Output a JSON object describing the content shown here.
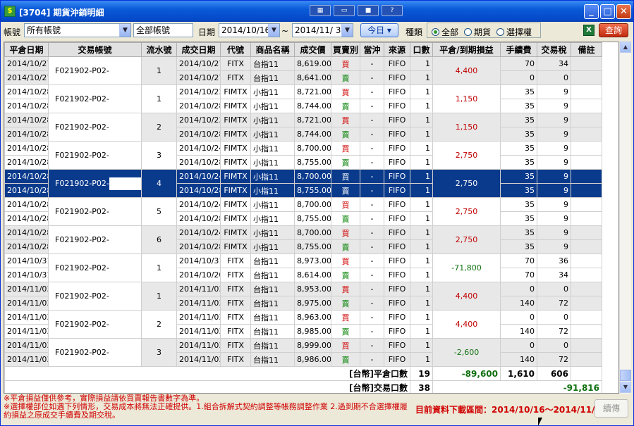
{
  "window": {
    "title": "[3704] 期貨沖銷明細",
    "toolbar_icons": [
      "grid-icon",
      "window-icon",
      "camera-icon",
      "help-icon"
    ],
    "help_label": "?"
  },
  "filters": {
    "account_label": "帳號",
    "account_value": "所有帳號",
    "account_name_value": "全部帳號",
    "date_label": "日期",
    "date_from": "2014/10/16",
    "date_sep": "~",
    "date_to": "2014/11/ 3",
    "today_button": "今日",
    "type_label": "種類",
    "type_options": [
      "全部",
      "期貨",
      "選擇權"
    ],
    "type_selected": "全部",
    "query_button": "查詢"
  },
  "table": {
    "columns": [
      "平倉日期",
      "交易帳號",
      "流水號",
      "成交日期",
      "代號",
      "商品名稱",
      "成交價",
      "買賣別",
      "當沖",
      "來源",
      "口數",
      "平倉/到期損益",
      "手續費",
      "交易稅",
      "備註"
    ],
    "groups": [
      {
        "close_date": "2014/10/27",
        "account": "F021902-P02-",
        "seq": "1",
        "pnl": "4,400",
        "pnl_sign": "pos",
        "rows": [
          {
            "close_date": "2014/10/27",
            "trade_date": "2014/10/27",
            "code": "FITX",
            "name": "台指11",
            "price": "8,619.00",
            "side": "買",
            "daytrade": "-",
            "source": "FIFO",
            "qty": "1",
            "fee": "70",
            "tax": "34"
          },
          {
            "close_date": "2014/10/27",
            "trade_date": "2014/10/27",
            "code": "FITX",
            "name": "台指11",
            "price": "8,641.00",
            "side": "賣",
            "daytrade": "-",
            "source": "FIFO",
            "qty": "1",
            "fee": "0",
            "tax": "0"
          }
        ]
      },
      {
        "close_date": "2014/10/28",
        "account": "F021902-P02-",
        "seq": "1",
        "pnl": "1,150",
        "pnl_sign": "pos",
        "rows": [
          {
            "close_date": "2014/10/28",
            "trade_date": "2014/10/23",
            "code": "FIMTX",
            "name": "小指11",
            "price": "8,721.00",
            "side": "買",
            "daytrade": "-",
            "source": "FIFO",
            "qty": "1",
            "fee": "35",
            "tax": "9"
          },
          {
            "close_date": "2014/10/28",
            "trade_date": "2014/10/28",
            "code": "FIMTX",
            "name": "小指11",
            "price": "8,744.00",
            "side": "賣",
            "daytrade": "-",
            "source": "FIFO",
            "qty": "1",
            "fee": "35",
            "tax": "9"
          }
        ]
      },
      {
        "close_date": "2014/10/28",
        "account": "F021902-P02-",
        "seq": "2",
        "pnl": "1,150",
        "pnl_sign": "pos",
        "rows": [
          {
            "close_date": "2014/10/28",
            "trade_date": "2014/10/23",
            "code": "FIMTX",
            "name": "小指11",
            "price": "8,721.00",
            "side": "買",
            "daytrade": "-",
            "source": "FIFO",
            "qty": "1",
            "fee": "35",
            "tax": "9"
          },
          {
            "close_date": "2014/10/28",
            "trade_date": "2014/10/28",
            "code": "FIMTX",
            "name": "小指11",
            "price": "8,744.00",
            "side": "賣",
            "daytrade": "-",
            "source": "FIFO",
            "qty": "1",
            "fee": "35",
            "tax": "9"
          }
        ]
      },
      {
        "close_date": "2014/10/28",
        "account": "F021902-P02-",
        "seq": "3",
        "pnl": "2,750",
        "pnl_sign": "pos",
        "rows": [
          {
            "close_date": "2014/10/28",
            "trade_date": "2014/10/24",
            "code": "FIMTX",
            "name": "小指11",
            "price": "8,700.00",
            "side": "買",
            "daytrade": "-",
            "source": "FIFO",
            "qty": "1",
            "fee": "35",
            "tax": "9"
          },
          {
            "close_date": "2014/10/28",
            "trade_date": "2014/10/28",
            "code": "FIMTX",
            "name": "小指11",
            "price": "8,755.00",
            "side": "賣",
            "daytrade": "-",
            "source": "FIFO",
            "qty": "1",
            "fee": "35",
            "tax": "9"
          }
        ]
      },
      {
        "close_date": "2014/10/28",
        "account": "F021902-P02-",
        "seq": "4",
        "pnl": "2,750",
        "pnl_sign": "pos",
        "selected": true,
        "rows": [
          {
            "close_date": "2014/10/28",
            "trade_date": "2014/10/24",
            "code": "FIMTX",
            "name": "小指11",
            "price": "8,700.00",
            "side": "買",
            "daytrade": "-",
            "source": "FIFO",
            "qty": "1",
            "fee": "35",
            "tax": "9"
          },
          {
            "close_date": "2014/10/28",
            "trade_date": "2014/10/28",
            "code": "FIMTX",
            "name": "小指11",
            "price": "8,755.00",
            "side": "賣",
            "daytrade": "-",
            "source": "FIFO",
            "qty": "1",
            "fee": "35",
            "tax": "9"
          }
        ]
      },
      {
        "close_date": "2014/10/28",
        "account": "F021902-P02-",
        "seq": "5",
        "pnl": "2,750",
        "pnl_sign": "pos",
        "rows": [
          {
            "close_date": "2014/10/28",
            "trade_date": "2014/10/24",
            "code": "FIMTX",
            "name": "小指11",
            "price": "8,700.00",
            "side": "買",
            "daytrade": "-",
            "source": "FIFO",
            "qty": "1",
            "fee": "35",
            "tax": "9"
          },
          {
            "close_date": "2014/10/28",
            "trade_date": "2014/10/28",
            "code": "FIMTX",
            "name": "小指11",
            "price": "8,755.00",
            "side": "賣",
            "daytrade": "-",
            "source": "FIFO",
            "qty": "1",
            "fee": "35",
            "tax": "9"
          }
        ]
      },
      {
        "close_date": "2014/10/28",
        "account": "F021902-P02-",
        "seq": "6",
        "pnl": "2,750",
        "pnl_sign": "pos",
        "rows": [
          {
            "close_date": "2014/10/28",
            "trade_date": "2014/10/24",
            "code": "FIMTX",
            "name": "小指11",
            "price": "8,700.00",
            "side": "買",
            "daytrade": "-",
            "source": "FIFO",
            "qty": "1",
            "fee": "35",
            "tax": "9"
          },
          {
            "close_date": "2014/10/28",
            "trade_date": "2014/10/28",
            "code": "FIMTX",
            "name": "小指11",
            "price": "8,755.00",
            "side": "賣",
            "daytrade": "-",
            "source": "FIFO",
            "qty": "1",
            "fee": "35",
            "tax": "9"
          }
        ]
      },
      {
        "close_date": "2014/10/31",
        "account": "F021902-P02-",
        "seq": "1",
        "pnl": "-71,800",
        "pnl_sign": "neg",
        "rows": [
          {
            "close_date": "2014/10/31",
            "trade_date": "2014/10/31",
            "code": "FITX",
            "name": "台指11",
            "price": "8,973.00",
            "side": "買",
            "daytrade": "-",
            "source": "FIFO",
            "qty": "1",
            "fee": "70",
            "tax": "36"
          },
          {
            "close_date": "2014/10/31",
            "trade_date": "2014/10/20",
            "code": "FITX",
            "name": "台指11",
            "price": "8,614.00",
            "side": "賣",
            "daytrade": "-",
            "source": "FIFO",
            "qty": "1",
            "fee": "70",
            "tax": "34"
          }
        ]
      },
      {
        "close_date": "2014/11/03",
        "account": "F021902-P02-",
        "seq": "1",
        "pnl": "4,400",
        "pnl_sign": "pos",
        "rows": [
          {
            "close_date": "2014/11/03",
            "trade_date": "2014/11/03",
            "code": "FITX",
            "name": "台指11",
            "price": "8,953.00",
            "side": "買",
            "daytrade": "-",
            "source": "FIFO",
            "qty": "1",
            "fee": "0",
            "tax": "0"
          },
          {
            "close_date": "2014/11/03",
            "trade_date": "2014/11/03",
            "code": "FITX",
            "name": "台指11",
            "price": "8,975.00",
            "side": "賣",
            "daytrade": "-",
            "source": "FIFO",
            "qty": "1",
            "fee": "140",
            "tax": "72"
          }
        ]
      },
      {
        "close_date": "2014/11/03",
        "account": "F021902-P02-",
        "seq": "2",
        "pnl": "4,400",
        "pnl_sign": "pos",
        "rows": [
          {
            "close_date": "2014/11/03",
            "trade_date": "2014/11/03",
            "code": "FITX",
            "name": "台指11",
            "price": "8,963.00",
            "side": "買",
            "daytrade": "-",
            "source": "FIFO",
            "qty": "1",
            "fee": "0",
            "tax": "0"
          },
          {
            "close_date": "2014/11/03",
            "trade_date": "2014/11/03",
            "code": "FITX",
            "name": "台指11",
            "price": "8,985.00",
            "side": "賣",
            "daytrade": "-",
            "source": "FIFO",
            "qty": "1",
            "fee": "140",
            "tax": "72"
          }
        ]
      },
      {
        "close_date": "2014/11/03",
        "account": "F021902-P02-",
        "seq": "3",
        "pnl": "-2,600",
        "pnl_sign": "neg",
        "rows": [
          {
            "close_date": "2014/11/03",
            "trade_date": "2014/11/03",
            "code": "FITX",
            "name": "台指11",
            "price": "8,999.00",
            "side": "買",
            "daytrade": "-",
            "source": "FIFO",
            "qty": "1",
            "fee": "0",
            "tax": "0"
          },
          {
            "close_date": "2014/11/03",
            "trade_date": "2014/11/03",
            "code": "FITX",
            "name": "台指11",
            "price": "8,986.00",
            "side": "賣",
            "daytrade": "-",
            "source": "FIFO",
            "qty": "1",
            "fee": "140",
            "tax": "72"
          }
        ]
      }
    ],
    "totals": {
      "close_label": "[台幣]平倉口數",
      "close_qty": "19",
      "close_pnl": "-89,600",
      "close_fee": "1,610",
      "close_tax": "606",
      "trade_label": "[台幣]交易口數",
      "trade_qty": "38",
      "trade_net": "-91,816"
    }
  },
  "footer": {
    "note1": "※平倉損益僅供參考，實際損益請依買賣報告書數字為準。",
    "note2": "※選擇權部位如遇下列情形，交易成本將無法正確提供。1.組合拆解式契約調整等帳務調整作業 2.過到期不合選擇權履約損益之原成交手續費及期交稅。",
    "range_label": "目前資料下載區間：2014/10/16～2014/11/3",
    "continue_button": "續傳"
  },
  "colors": {
    "titlebar": "#0549c9",
    "selected_row": "#0a3a8c",
    "buy": "#d00000",
    "sell": "#008000",
    "note": "#d00000"
  }
}
